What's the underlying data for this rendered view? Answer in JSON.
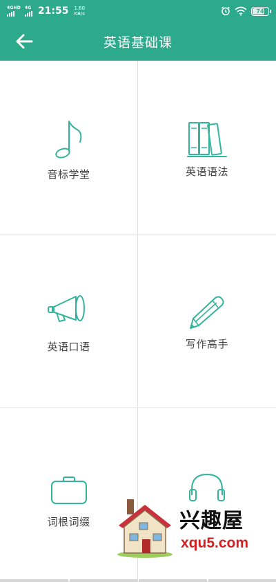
{
  "status_bar": {
    "sim1_label": "4GHD",
    "sim2_label": "4G",
    "time": "21:55",
    "speed_value": "1.60",
    "speed_unit": "KB/s",
    "battery": "74"
  },
  "header": {
    "title": "英语基础课",
    "back_icon": "arrow-left-icon"
  },
  "grid": {
    "items": [
      {
        "label": "音标学堂",
        "icon": "music-note-icon"
      },
      {
        "label": "英语语法",
        "icon": "books-icon"
      },
      {
        "label": "英语口语",
        "icon": "megaphone-icon"
      },
      {
        "label": "写作高手",
        "icon": "pencil-icon"
      },
      {
        "label": "词根词缀",
        "icon": "briefcase-icon"
      },
      {
        "label": "",
        "icon": "headphones-icon"
      }
    ]
  },
  "watermark": {
    "text": "兴趣屋",
    "url": "xqu5.com"
  },
  "colors": {
    "primary": "#2daa8c",
    "icon_stroke": "#33b59b",
    "divider": "#ead8ee",
    "label_text": "#444444"
  }
}
